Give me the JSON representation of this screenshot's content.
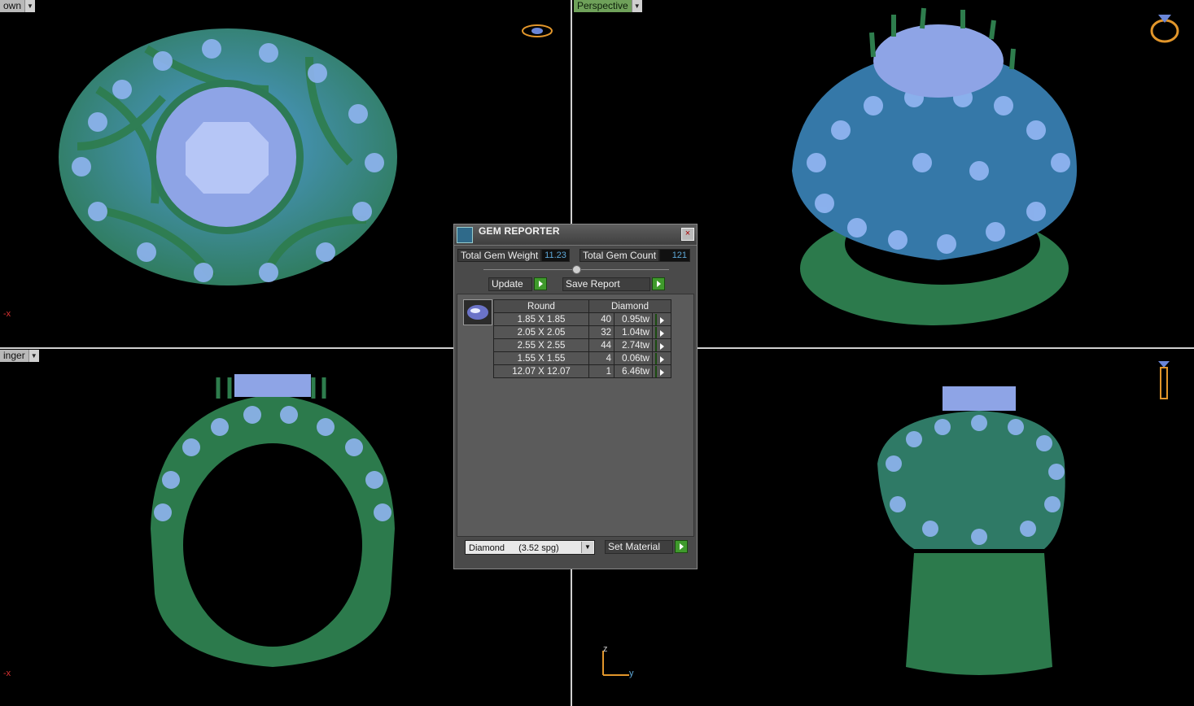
{
  "viewports": {
    "top_label": "own",
    "perspective_label": "Perspective",
    "front_label": "inger",
    "x_axis_label": "-x",
    "z_axis_label": "z",
    "y_axis_label": "y"
  },
  "gem_reporter": {
    "title": "GEM REPORTER",
    "close_label": "×",
    "total_weight_label": "Total Gem Weight",
    "total_weight_value": "11.23",
    "total_count_label": "Total Gem Count",
    "total_count_value": "121",
    "update_label": "Update",
    "save_report_label": "Save Report",
    "table": {
      "header_cut": "Round",
      "header_material": "Diamond",
      "rows": [
        {
          "size": "1.85 X 1.85",
          "count": "40",
          "weight": "0.95tw"
        },
        {
          "size": "2.05 X 2.05",
          "count": "32",
          "weight": "1.04tw"
        },
        {
          "size": "2.55 X 2.55",
          "count": "44",
          "weight": "2.74tw"
        },
        {
          "size": "1.55 X 1.55",
          "count": "4",
          "weight": "0.06tw"
        },
        {
          "size": "12.07 X 12.07",
          "count": "1",
          "weight": "6.46tw"
        }
      ]
    },
    "material_select_name": "Diamond",
    "material_select_spg": "(3.52 spg)",
    "set_material_label": "Set Material"
  },
  "colors": {
    "metal": "#2f7a4c",
    "gem": "#8fb4f0",
    "accent_green": "#3f9a2c"
  }
}
